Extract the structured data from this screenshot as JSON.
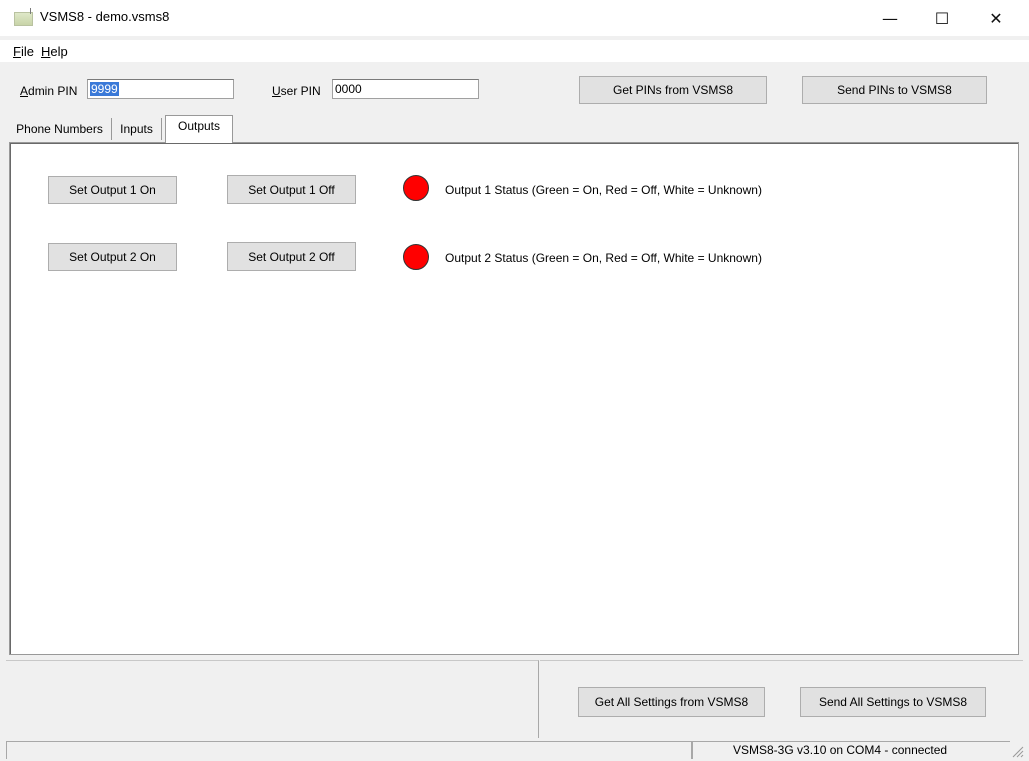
{
  "window": {
    "title": "VSMS8 - demo.vsms8",
    "minimize_glyph": "—",
    "maximize_glyph": "☐",
    "close_glyph": "✕"
  },
  "menu": {
    "items": [
      {
        "label": "File",
        "mnemonic": "F",
        "rest": "ile"
      },
      {
        "label": "Help",
        "mnemonic": "H",
        "rest": "elp"
      }
    ]
  },
  "pins": {
    "admin_label_mnemonic": "A",
    "admin_label_rest": "dmin PIN",
    "admin_value": "9999",
    "user_label_mnemonic": "U",
    "user_label_rest": "ser PIN",
    "user_value": "0000",
    "get_button": "Get PINs from VSMS8",
    "send_button": "Send PINs to VSMS8"
  },
  "tabs": [
    {
      "label": "Phone Numbers",
      "active": false
    },
    {
      "label": "Inputs",
      "active": false
    },
    {
      "label": "Outputs",
      "active": true
    }
  ],
  "outputs": [
    {
      "on_label": "Set Output 1 On",
      "off_label": "Set Output 1 Off",
      "status_text": "Output 1 Status (Green = On, Red = Off, White = Unknown)",
      "status_color": "#ff0000"
    },
    {
      "on_label": "Set Output 2 On",
      "off_label": "Set Output 2 Off",
      "status_text": "Output 2 Status (Green = On, Red = Off, White = Unknown)",
      "status_color": "#ff0000"
    }
  ],
  "footer": {
    "get_all": "Get All Settings from VSMS8",
    "send_all": "Send All Settings to VSMS8"
  },
  "statusbar": {
    "left_text": "",
    "connection_text": "VSMS8-3G v3.10 on COM4 - connected"
  }
}
